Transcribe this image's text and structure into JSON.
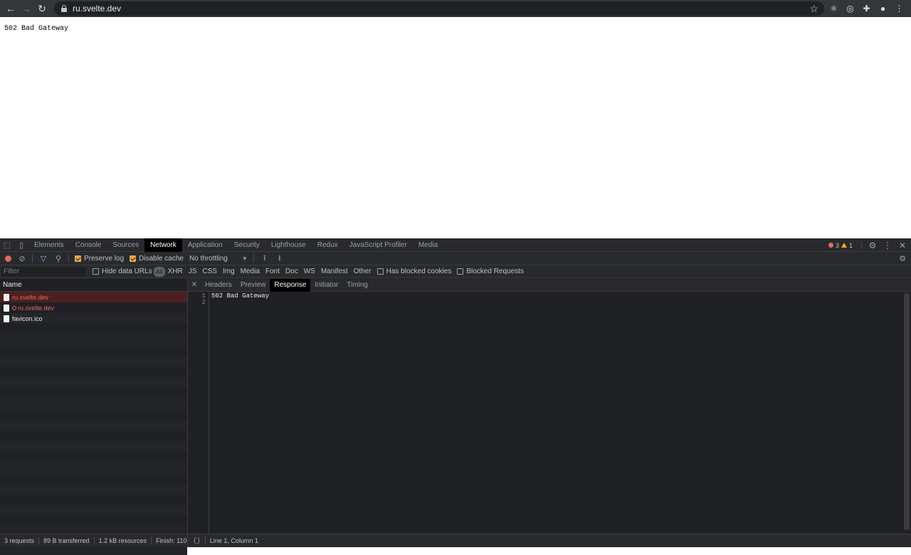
{
  "browser": {
    "url": "ru.svelte.dev"
  },
  "page": {
    "body_text": "502 Bad Gateway"
  },
  "devtools": {
    "tabs": [
      "Elements",
      "Console",
      "Sources",
      "Network",
      "Application",
      "Security",
      "Lighthouse",
      "Redux",
      "JavaScript Profiler",
      "Media"
    ],
    "active_tab": "Network",
    "error_count": "3",
    "warning_count": "1",
    "toolbar": {
      "preserve_log": "Preserve log",
      "disable_cache": "Disable cache",
      "throttling": "No throttling"
    },
    "filter": {
      "placeholder": "Filter",
      "hide_data_urls": "Hide data URLs",
      "types": [
        "All",
        "XHR",
        "JS",
        "CSS",
        "Img",
        "Media",
        "Font",
        "Doc",
        "WS",
        "Manifest",
        "Other"
      ],
      "has_blocked_cookies": "Has blocked cookies",
      "blocked_requests": "Blocked Requests"
    },
    "requests": {
      "header": "Name",
      "rows": [
        {
          "name": "ru.svelte.dev"
        },
        {
          "name": "ru.svelte.dev"
        },
        {
          "name": "favicon.ico"
        }
      ]
    },
    "response": {
      "tabs": [
        "Headers",
        "Preview",
        "Response",
        "Initiator",
        "Timing"
      ],
      "active_tab": "Response",
      "line_numbers": [
        "1",
        "2"
      ],
      "content": "502 Bad Gateway"
    },
    "status": {
      "requests": "3 requests",
      "transferred": "89 B transferred",
      "resources": "1.2 kB resources",
      "finish": "Finish: 110 ms",
      "position": "Line 1, Column 1"
    }
  }
}
